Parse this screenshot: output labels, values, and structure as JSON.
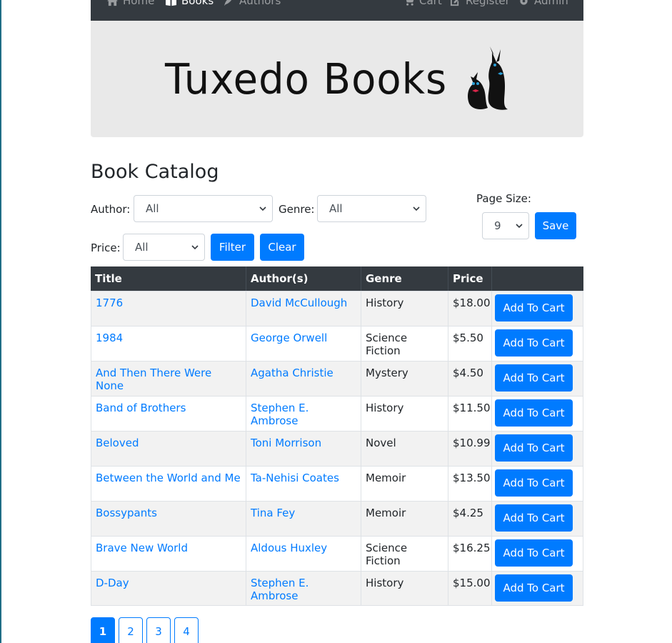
{
  "nav": {
    "home": "Home",
    "books": "Books",
    "authors": "Authors",
    "cart": "Cart",
    "register": "Register",
    "admin": "Admin"
  },
  "brand": {
    "logo_text": "Tuxedo Books"
  },
  "page": {
    "title": "Book Catalog"
  },
  "filters": {
    "author_label": "Author:",
    "author_value": "All",
    "genre_label": "Genre:",
    "genre_value": "All",
    "price_label": "Price:",
    "price_value": "All",
    "filter_button": "Filter",
    "clear_button": "Clear",
    "page_size_label": "Page Size:",
    "page_size_value": "9",
    "save_button": "Save"
  },
  "table": {
    "headers": [
      "Title",
      "Author(s)",
      "Genre",
      "Price",
      ""
    ],
    "cart_label": "Add To Cart",
    "rows": [
      {
        "title": "1776",
        "author": "David McCullough",
        "genre": "History",
        "price": "$18.00"
      },
      {
        "title": "1984",
        "author": "George Orwell",
        "genre": "Science Fiction",
        "price": "$5.50"
      },
      {
        "title": "And Then There Were None",
        "author": "Agatha Christie",
        "genre": "Mystery",
        "price": "$4.50"
      },
      {
        "title": "Band of Brothers",
        "author": "Stephen E. Ambrose",
        "genre": "History",
        "price": "$11.50"
      },
      {
        "title": "Beloved",
        "author": "Toni Morrison",
        "genre": "Novel",
        "price": "$10.99"
      },
      {
        "title": "Between the World and Me",
        "author": "Ta-Nehisi Coates",
        "genre": "Memoir",
        "price": "$13.50"
      },
      {
        "title": "Bossypants",
        "author": "Tina Fey",
        "genre": "Memoir",
        "price": "$4.25"
      },
      {
        "title": "Brave New World",
        "author": "Aldous Huxley",
        "genre": "Science Fiction",
        "price": "$16.25"
      },
      {
        "title": "D-Day",
        "author": "Stephen E. Ambrose",
        "genre": "History",
        "price": "$15.00"
      }
    ]
  },
  "pagination": {
    "pages": [
      "1",
      "2",
      "3",
      "4"
    ],
    "current": "1"
  },
  "colors": {
    "primary": "#007bff",
    "navbar": "#343a40",
    "banner": "#e9e9e9"
  }
}
